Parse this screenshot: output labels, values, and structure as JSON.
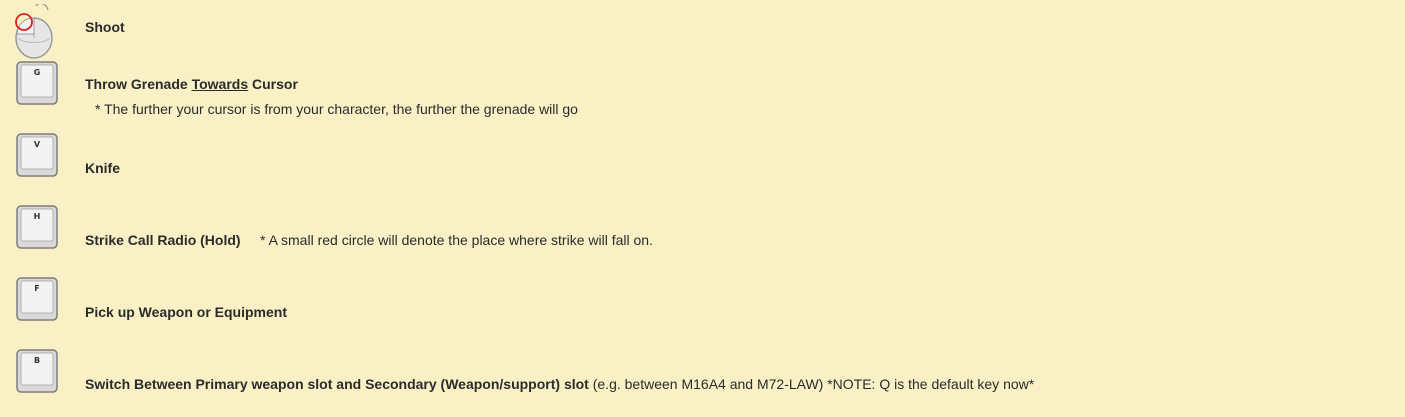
{
  "rows": [
    {
      "key": "",
      "icon": "mouse-left-click-icon",
      "label": "Shoot"
    },
    {
      "key": "G",
      "icon": "keyboard-key-g-icon",
      "label_before": "Throw Grenade ",
      "label_underline": "Towards",
      "label_after": " Cursor",
      "note": "* The further your cursor is from your character, the further the grenade will go"
    },
    {
      "key": "V",
      "icon": "keyboard-key-v-icon",
      "label": "Knife"
    },
    {
      "key": "H",
      "icon": "keyboard-key-h-icon",
      "label": "Strike Call Radio (Hold)",
      "note": "* A small red circle will denote the place where strike will fall on."
    },
    {
      "key": "F",
      "icon": "keyboard-key-f-icon",
      "label": "Pick up Weapon or Equipment"
    },
    {
      "key": "B",
      "icon": "keyboard-key-b-icon",
      "label": "Switch Between Primary weapon slot and Secondary (Weapon/support) slot",
      "note": "(e.g. between M16A4 and M72-LAW) *NOTE: Q is the default key now*"
    }
  ],
  "colors": {
    "background": "#f9f1c5",
    "text": "#2b2b2b",
    "mouse_highlight": "#d42020"
  }
}
